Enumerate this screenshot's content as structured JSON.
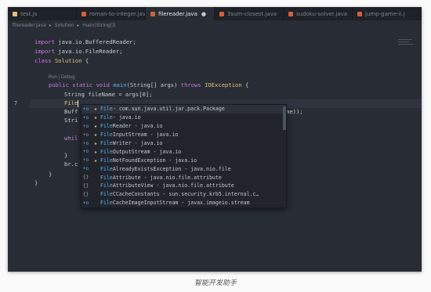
{
  "tabs": [
    {
      "label": "test.js",
      "active": false,
      "icon": "js-file-icon",
      "color": "#e5c07b"
    },
    {
      "label": "roman-to-integer.java",
      "active": false,
      "icon": "java-file-icon",
      "color": "#d1603d"
    },
    {
      "label": "filereader.java",
      "active": true,
      "icon": "java-file-icon",
      "color": "#d1603d",
      "modified": "●"
    },
    {
      "label": "3sum-closest.java",
      "active": false,
      "icon": "java-file-icon",
      "color": "#d1603d"
    },
    {
      "label": "sudoku-solver.java",
      "active": false,
      "icon": "java-file-icon",
      "color": "#d1603d"
    },
    {
      "label": "jump-game-ii.j",
      "active": false,
      "icon": "java-file-icon",
      "color": "#d1603d"
    }
  ],
  "breadcrumb": {
    "file": "filereader.java",
    "sep1": "▸",
    "cls": "Solution",
    "sep2": "▸",
    "method": "main(String[])"
  },
  "code": {
    "l1_kw": "import",
    "l1_rest": " java.io.BufferedReader;",
    "l2_kw": "import",
    "l2_rest": " java.io.FileReader;",
    "l3_kw": "class",
    "l3_name": " Solution",
    "l3_rest": " {",
    "lens": "Run | Debug",
    "l5_a": "public static void",
    "l5_fn": " main",
    "l5_b": "(String[] args) ",
    "l5_kw": "throws",
    "l5_ty": " IOException",
    "l5_c": " {",
    "l6": "String fileName = args[0];",
    "l7": "File",
    "l8_a": "Buff",
    "l8_b": "me));",
    "l9": "Stri",
    "l10": "whil",
    "l11": "}",
    "l12": "br.c",
    "l13": "}",
    "l14": "}"
  },
  "line_number_current": "7",
  "suggestions": [
    {
      "kind": "+o",
      "star": "★",
      "pre": "File",
      "rest": " - com.sun.java.util.jar.pack.Package",
      "selected": true
    },
    {
      "kind": "+o",
      "star": "★",
      "pre": "File",
      "rest": " - java.io",
      "selected": false
    },
    {
      "kind": "+o",
      "star": "★",
      "pre": "File",
      "rest": "Reader - java.io",
      "selected": false
    },
    {
      "kind": "+o",
      "star": "★",
      "pre": "File",
      "rest": "InputStream - java.io",
      "selected": false
    },
    {
      "kind": "+o",
      "star": "★",
      "pre": "File",
      "rest": "Writer - java.io",
      "selected": false
    },
    {
      "kind": "+o",
      "star": "★",
      "pre": "File",
      "rest": "OutputStream - java.io",
      "selected": false
    },
    {
      "kind": "+o",
      "star": "★",
      "pre": "File",
      "rest": "NotFoundException - java.io",
      "selected": false
    },
    {
      "kind": "+o",
      "star": "",
      "pre": "File",
      "rest": "AlreadyExistsException - java.nio.file",
      "selected": false
    },
    {
      "kind": "{}",
      "star": "",
      "pre": "File",
      "rest": "Attribute - java.nio.file.attribute",
      "selected": false
    },
    {
      "kind": "{}",
      "star": "",
      "pre": "File",
      "rest": "AttributeView - java.nio.file.attribute",
      "selected": false
    },
    {
      "kind": "{}",
      "star": "",
      "pre": "File",
      "rest": "CCacheConstants - sun.security.krb5.internal.c…",
      "selected": false
    },
    {
      "kind": "+o",
      "star": "",
      "pre": "File",
      "rest": "CacheImageInputStream - javax.imageio.stream",
      "selected": false
    }
  ],
  "caption": "智能开发助手"
}
